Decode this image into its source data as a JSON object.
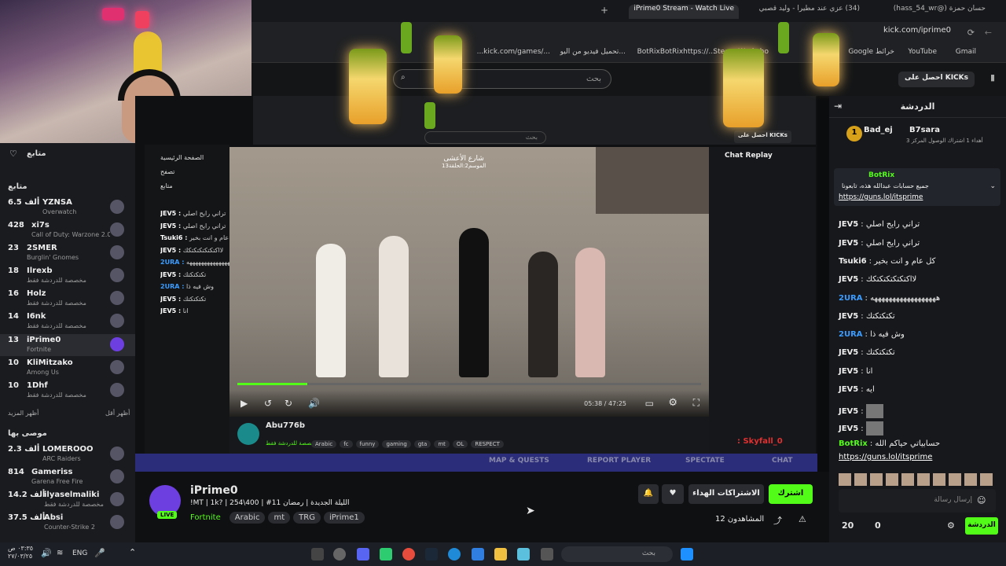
{
  "tabs": [
    {
      "label": "حسان حمزة (@hass_54_wr)",
      "active": false
    },
    {
      "label": "(34) عزي عند مطيرا - وليد قصبي",
      "active": false
    },
    {
      "label": "iPrime0 Stream - Watch Live",
      "active": true
    }
  ],
  "url": "kick.com/iprime0",
  "bookmarks": [
    "Gmail",
    "YouTube",
    "Google خرائط",
    "Steam Worksho",
    "BotRixBotRixhttps://...",
    "تحميل فيديو من اليو...",
    "...kick.com/games/..."
  ],
  "header": {
    "search_placeholder": "بحث",
    "get_kicks": "احصل على KICKs"
  },
  "sidebar": {
    "following_title": "متابع",
    "following_sub": "متابع",
    "channels": [
      {
        "name": "YZNSA",
        "count": "6.5 ألف",
        "game": "Overwatch"
      },
      {
        "name": "xi7s",
        "count": "428",
        "game": "Call of Duty: Warzone 2.0"
      },
      {
        "name": "2SMER",
        "count": "23",
        "game": "Burglin' Gnomes"
      },
      {
        "name": "Ilrexb",
        "count": "18",
        "game": "مخصصة للدردشة فقط"
      },
      {
        "name": "Holz",
        "count": "16",
        "game": "مخصصة للدردشة فقط"
      },
      {
        "name": "I6nk",
        "count": "14",
        "game": "مخصصة للدردشة فقط"
      },
      {
        "name": "iPrime0",
        "count": "13",
        "game": "Fortnite",
        "selected": true
      },
      {
        "name": "KliMitzako",
        "count": "10",
        "game": "Among Us"
      },
      {
        "name": "1Dhf",
        "count": "10",
        "game": "مخصصة للدردشة فقط"
      }
    ],
    "show_more": "أظهر المزيد",
    "show_less": "أظهر أقل",
    "recommended_title": "موصى بها",
    "recommended": [
      {
        "name": "LOMEROOO",
        "count": "2.3 ألف",
        "game": "ARC Raiders"
      },
      {
        "name": "Gameriss",
        "count": "814",
        "game": "Garena Free Fire"
      },
      {
        "name": "ilyaselmaliki",
        "count": "14.2 ألف",
        "game": "مخصصة للدردشة فقط"
      },
      {
        "name": "Absi",
        "count": "37.5 ألف",
        "game": "Counter-Strike 2"
      }
    ]
  },
  "inner": {
    "video_title": "شارع الأعشى",
    "video_subtitle": "الموسم2:الحلقة13",
    "time": "05:38 / 47:25",
    "chat_replay": "Chat Replay",
    "streamer": "Abu776b",
    "streamer_sub": "مخصصة للدردشة فقط",
    "tags": [
      "Arabic",
      "fc",
      "funny",
      "gaming",
      "gta",
      "mt",
      "OL",
      "RESPECT"
    ],
    "game_bar": [
      "MAP & QUESTS",
      "REPORT PLAYER",
      "SPECTATE",
      "CHAT"
    ],
    "overlay_name": ": Skyfall_0",
    "nav_home": "الصفحة الرئيسية",
    "nav_browse": "تصفح",
    "nav_following": "متابع",
    "progress": 0.15
  },
  "chat": {
    "title": "الدردشة",
    "top_gifter": "Bad_ej",
    "top_gifter2": "B7sara",
    "top_gifter_sub": "أهداء 1 اشتراك الوصول المركز 3",
    "pinned_user": "BotRix",
    "pinned_text": "جميع حسابات عبدالله هذه، تابعونا",
    "pinned_link": "https://guns.lol/itsprime",
    "messages": [
      {
        "user": "JEV5",
        "text": "تراني رايح اصلي",
        "color": "#fff"
      },
      {
        "user": "JEV5",
        "text": "تراني رايح اصلي",
        "color": "#fff"
      },
      {
        "user": "Tsuki6",
        "text": "كل عام و انت بخير",
        "color": "#fff"
      },
      {
        "user": "JEV5",
        "text": "لااكتكتكتكتكتكك",
        "color": "#fff"
      },
      {
        "user": "2URA",
        "text": "ههههههههههههههههههه",
        "color": "#3a9cff"
      },
      {
        "user": "JEV5",
        "text": "تكتكتكتك",
        "color": "#fff"
      },
      {
        "user": "2URA",
        "text": "وش فيه ذا",
        "color": "#3a9cff"
      },
      {
        "user": "JEV5",
        "text": "تكتكتكتك",
        "color": "#fff"
      },
      {
        "user": "JEV5",
        "text": "انا",
        "color": "#fff"
      },
      {
        "user": "JEV5",
        "text": "ايه",
        "color": "#fff"
      }
    ],
    "botrix_user": "BotRix",
    "botrix_text": "حسابياتي حياكم الله",
    "botrix_link": "https://guns.lol/itsprime",
    "input_placeholder": "إرسال رسالة",
    "send_label": "الدردشة",
    "points": "20",
    "kicks": "0"
  },
  "stream": {
    "name": "iPrime0",
    "live": "LIVE",
    "title": "!MT | 1k? | 254\\400 | #11 الليلة الجديدة | رمضان",
    "tags": [
      "Fortnite",
      "Arabic",
      "mt",
      "TRG",
      "iPrime1"
    ],
    "follow": "اشترك",
    "gift_subs": "الاشتراكات الهداء",
    "viewers": "12 المشاهدون"
  },
  "taskbar": {
    "time": "٠٣:٣٥ ص",
    "date": "٢٧/٠٣/٢٥",
    "lang": "ENG",
    "search": "بحث"
  },
  "colors": {
    "accent": "#53fc18",
    "bg": "#0b0c0e",
    "selected": "#2a2c31"
  }
}
